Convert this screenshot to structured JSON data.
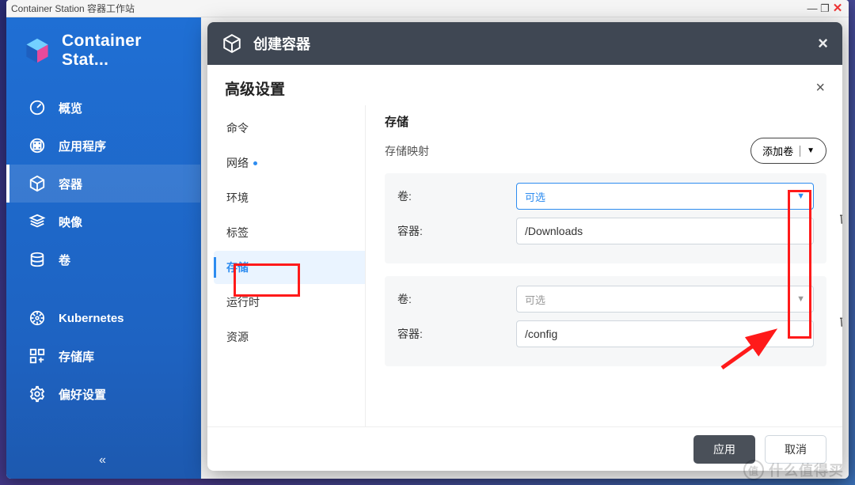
{
  "window": {
    "title": "Container Station 容器工作站"
  },
  "sidebar": {
    "brand": "Container Stat...",
    "items": [
      {
        "label": "概览"
      },
      {
        "label": "应用程序"
      },
      {
        "label": "容器",
        "active": true
      },
      {
        "label": "映像"
      },
      {
        "label": "卷"
      }
    ],
    "items2": [
      {
        "label": "Kubernetes"
      },
      {
        "label": "存储库"
      },
      {
        "label": "偏好设置"
      }
    ]
  },
  "modal": {
    "title": "创建容器",
    "advanced_title": "高级设置",
    "subtabs": {
      "cmd": "命令",
      "net": "网络",
      "env": "环境",
      "tag": "标签",
      "storage": "存储",
      "runtime": "运行时",
      "resource": "资源"
    },
    "panel": {
      "heading": "存储",
      "mapping_label": "存储映射",
      "add_volume": "添加卷",
      "row_volume_label": "卷:",
      "row_container_label": "容器:",
      "select_placeholder": "可选",
      "blocks": [
        {
          "container_path": "/Downloads"
        },
        {
          "container_path": "/config"
        }
      ]
    },
    "footer": {
      "apply": "应用",
      "cancel": "取消"
    }
  },
  "watermark": "什么值得买"
}
